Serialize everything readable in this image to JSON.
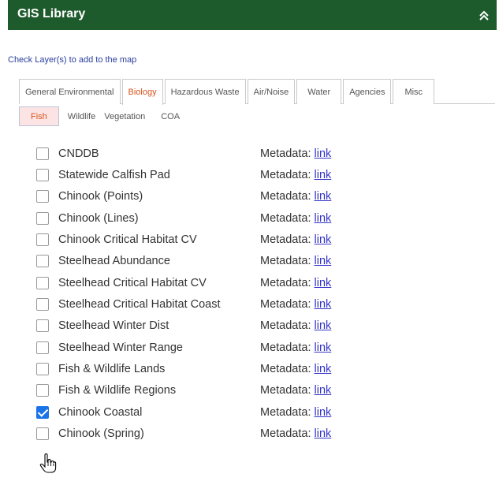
{
  "header": {
    "title": "GIS Library",
    "collapse_icon": "double-chevron-up-icon"
  },
  "hint": "Check Layer(s) to add to the map",
  "tabs": [
    {
      "label": "General Environmental",
      "active": false
    },
    {
      "label": "Biology",
      "active": true
    },
    {
      "label": "Hazardous Waste",
      "active": false
    },
    {
      "label": "Air/Noise",
      "active": false
    },
    {
      "label": "Water",
      "active": false
    },
    {
      "label": "Agencies",
      "active": false
    },
    {
      "label": "Misc",
      "active": false
    }
  ],
  "subtabs": [
    {
      "label": "Fish",
      "active": true
    },
    {
      "label": "Wildlife",
      "active": false
    },
    {
      "label": "Vegetation",
      "active": false
    },
    {
      "label": "COA",
      "active": false
    }
  ],
  "metadata_label": "Metadata:",
  "link_label": "link",
  "layers": [
    {
      "name": "CNDDB",
      "checked": false
    },
    {
      "name": "Statewide Calfish Pad",
      "checked": false
    },
    {
      "name": "Chinook (Points)",
      "checked": false
    },
    {
      "name": "Chinook (Lines)",
      "checked": false
    },
    {
      "name": "Chinook Critical Habitat CV",
      "checked": false
    },
    {
      "name": "Steelhead Abundance",
      "checked": false
    },
    {
      "name": "Steelhead Critical Habitat CV",
      "checked": false
    },
    {
      "name": "Steelhead Critical Habitat Coast",
      "checked": false
    },
    {
      "name": "Steelhead Winter Dist",
      "checked": false
    },
    {
      "name": "Steelhead Winter Range",
      "checked": false
    },
    {
      "name": "Fish & Wildlife Lands",
      "checked": false
    },
    {
      "name": "Fish & Wildlife Regions",
      "checked": false
    },
    {
      "name": "Chinook Coastal",
      "checked": true
    },
    {
      "name": "Chinook (Spring)",
      "checked": false
    }
  ],
  "colors": {
    "header_bg": "#1e5b2c",
    "active_tab_text": "#d9541e",
    "link": "#3434c8",
    "hint": "#2a3f9e"
  }
}
